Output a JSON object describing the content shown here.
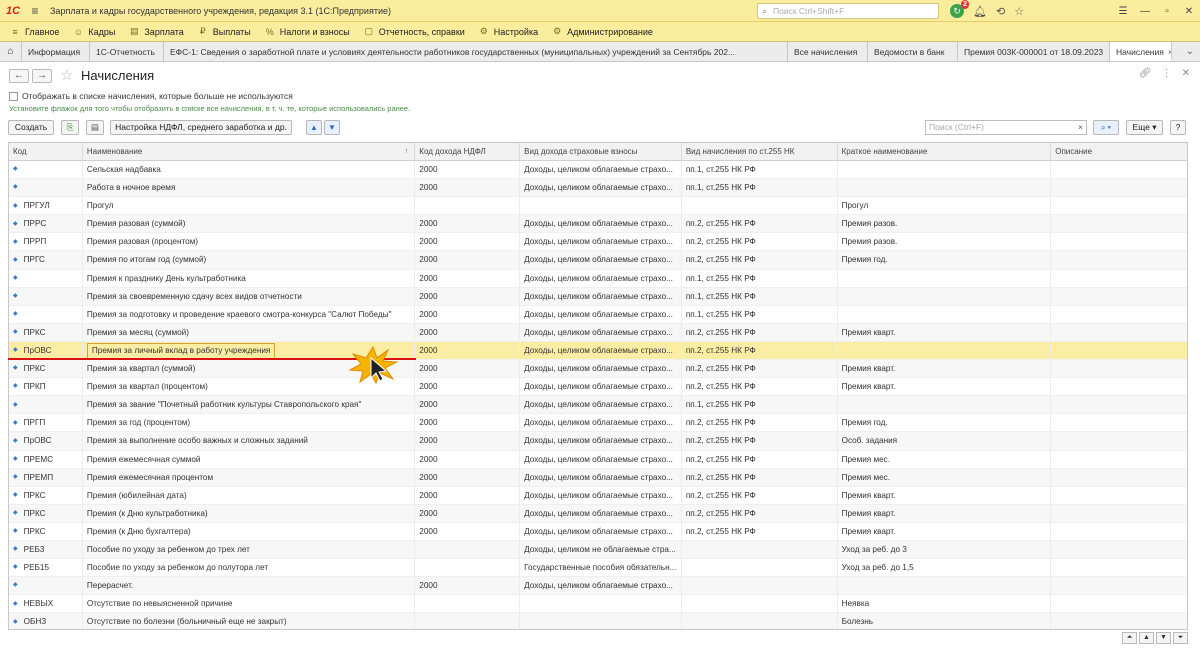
{
  "titlebar": {
    "logo": "1С",
    "title": "Зарплата и кадры государственного учреждения, редакция 3.1  (1С:Предприятие)",
    "search_placeholder": "Поиск Ctrl+Shift+F",
    "notif_count": "2"
  },
  "menu": [
    {
      "icon": "≡",
      "label": "Главное"
    },
    {
      "icon": "☺",
      "label": "Кадры"
    },
    {
      "icon": "▤",
      "label": "Зарплата"
    },
    {
      "icon": "₽",
      "label": "Выплаты"
    },
    {
      "icon": "%",
      "label": "Налоги и взносы"
    },
    {
      "icon": "▢",
      "label": "Отчетность, справки"
    },
    {
      "icon": "⚙",
      "label": "Настройка"
    },
    {
      "icon": "⚙",
      "label": "Администрирование"
    }
  ],
  "tabs": [
    {
      "label": "Информация"
    },
    {
      "label": "1С-Отчетность"
    },
    {
      "label": "ЕФС-1: Сведения о заработной плате и условиях деятельности работников государственных (муниципальных) учреждений за Сентябрь 202..."
    },
    {
      "label": "Все начисления"
    },
    {
      "label": "Ведомости в банк"
    },
    {
      "label": "Премия 003К-000001 от 18.09.2023"
    },
    {
      "label": "Начисления"
    }
  ],
  "form": {
    "title": "Начисления",
    "checkbox_label": "Отображать в списке начисления, которые больше не используются",
    "hint": "Установите флажок для того чтобы отобразить в списке все начисления, в т. ч. те, которые использовались ранее.",
    "create_label": "Создать",
    "settings_label": "Настройка НДФЛ, среднего заработка и др.",
    "search_placeholder": "Поиск (Ctrl+F)",
    "more_label": "Еще",
    "help_label": "?"
  },
  "columns": [
    "Код",
    "Наименование",
    "Код дохода НДФЛ",
    "Вид дохода страховые взносы",
    "Вид начисления по ст.255 НК",
    "Краткое наименование",
    "Описание"
  ],
  "rows": [
    [
      "",
      "Сельская надбавка",
      "2000",
      "Доходы, целиком облагаемые страхо...",
      "пп.1, ст.255 НК РФ",
      "",
      ""
    ],
    [
      "",
      "Работа в ночное время",
      "2000",
      "Доходы, целиком облагаемые страхо...",
      "пп.1, ст.255 НК РФ",
      "",
      ""
    ],
    [
      "ПРГУЛ",
      "Прогул",
      "",
      "",
      "",
      "Прогул",
      ""
    ],
    [
      "ПРРС",
      "Премия разовая (суммой)",
      "2000",
      "Доходы, целиком облагаемые страхо...",
      "пп.2, ст.255 НК РФ",
      "Премия разов.",
      ""
    ],
    [
      "ПРРП",
      "Премия разовая (процентом)",
      "2000",
      "Доходы, целиком облагаемые страхо...",
      "пп.2, ст.255 НК РФ",
      "Премия разов.",
      ""
    ],
    [
      "ПРГС",
      "Премия по итогам год (суммой)",
      "2000",
      "Доходы, целиком облагаемые страхо...",
      "пп.2, ст.255 НК РФ",
      "Премия год.",
      ""
    ],
    [
      "",
      "Премия к празднику День культработника",
      "2000",
      "Доходы, целиком облагаемые страхо...",
      "пп.1, ст.255 НК РФ",
      "",
      ""
    ],
    [
      "",
      "Премия за своевременную сдачу всех видов отчетности",
      "2000",
      "Доходы, целиком облагаемые страхо...",
      "пп.1, ст.255 НК РФ",
      "",
      ""
    ],
    [
      "",
      "Премия за подготовку и проведение краевого смотра-конкурса \"Салют Победы\"",
      "2000",
      "Доходы, целиком облагаемые страхо...",
      "пп.1, ст.255 НК РФ",
      "",
      ""
    ],
    [
      "ПРКС",
      "Премия за месяц (суммой)",
      "2000",
      "Доходы, целиком облагаемые страхо...",
      "пп.2, ст.255 НК РФ",
      "Премия кварт.",
      ""
    ],
    [
      "ПрОВС",
      "Премия за личный вклад в работу учреждения",
      "2000",
      "Доходы, целиком облагаемые страхо...",
      "пп.2, ст.255 НК РФ",
      "",
      ""
    ],
    [
      "ПРКС",
      "Премия за квартал (суммой)",
      "2000",
      "Доходы, целиком облагаемые страхо...",
      "пп.2, ст.255 НК РФ",
      "Премия кварт.",
      ""
    ],
    [
      "ПРКП",
      "Премия за квартал (процентом)",
      "2000",
      "Доходы, целиком облагаемые страхо...",
      "пп.2, ст.255 НК РФ",
      "Премия кварт.",
      ""
    ],
    [
      "",
      "Премия за звание \"Почетный работник культуры Ставропольского края\"",
      "2000",
      "Доходы, целиком облагаемые страхо...",
      "пп.1, ст.255 НК РФ",
      "",
      ""
    ],
    [
      "ПРГП",
      "Премия за год (процентом)",
      "2000",
      "Доходы, целиком облагаемые страхо...",
      "пп.2, ст.255 НК РФ",
      "Премия год.",
      ""
    ],
    [
      "ПрОВС",
      "Премия за выполнение особо важных и сложных заданий",
      "2000",
      "Доходы, целиком облагаемые страхо...",
      "пп.2, ст.255 НК РФ",
      "Особ. задания",
      ""
    ],
    [
      "ПРЕМС",
      "Премия ежемесячная суммой",
      "2000",
      "Доходы, целиком облагаемые страхо...",
      "пп.2, ст.255 НК РФ",
      "Премия мес.",
      ""
    ],
    [
      "ПРЕМП",
      "Премия ежемесячная процентом",
      "2000",
      "Доходы, целиком облагаемые страхо...",
      "пп.2, ст.255 НК РФ",
      "Премия мес.",
      ""
    ],
    [
      "ПРКС",
      "Премия (юбилейная дата)",
      "2000",
      "Доходы, целиком облагаемые страхо...",
      "пп.2, ст.255 НК РФ",
      "Премия кварт.",
      ""
    ],
    [
      "ПРКС",
      "Премия (к Дню культработника)",
      "2000",
      "Доходы, целиком облагаемые страхо...",
      "пп.2, ст.255 НК РФ",
      "Премия кварт.",
      ""
    ],
    [
      "ПРКС",
      "Премия (к Дню бухгалтера)",
      "2000",
      "Доходы, целиком облагаемые страхо...",
      "пп.2, ст.255 НК РФ",
      "Премия кварт.",
      ""
    ],
    [
      "РЕБ3",
      "Пособие по уходу за ребенком до трех лет",
      "",
      "Доходы, целиком не облагаемые стра...",
      "",
      "Уход за реб. до 3",
      ""
    ],
    [
      "РЕБ15",
      "Пособие по уходу за ребенком до полутора лет",
      "",
      "Государственные пособия обязательн...",
      "",
      "Уход за реб. до 1,5",
      ""
    ],
    [
      "",
      "Перерасчет.",
      "2000",
      "Доходы, целиком облагаемые страхо...",
      "",
      "",
      ""
    ],
    [
      "НЕВЫХ",
      "Отсутствие по невыясненной причине",
      "",
      "",
      "",
      "Неявка",
      ""
    ],
    [
      "ОБНЗ",
      "Отсутствие по болезни (больничный еще не закрыт)",
      "",
      "",
      "",
      "Болезнь",
      ""
    ]
  ],
  "selected_row": 10
}
